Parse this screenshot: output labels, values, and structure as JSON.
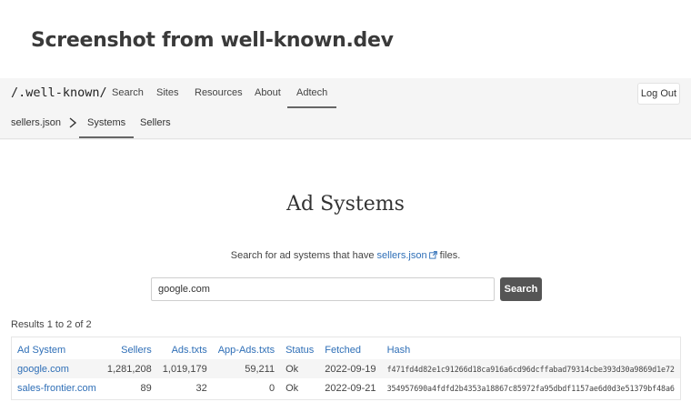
{
  "page_title": "Screenshot from well-known.dev",
  "topnav": {
    "brand": "/.well-known/",
    "items": [
      "Search",
      "Sites",
      "Resources",
      "About",
      "Adtech"
    ],
    "active": "Adtech",
    "logout_label": "Log Out"
  },
  "subnav": {
    "root": "sellers.json",
    "items": [
      "Systems",
      "Sellers"
    ],
    "active": "Systems"
  },
  "main": {
    "title": "Ad Systems",
    "subtitle_prefix": "Search for ad systems that have",
    "subtitle_link": "sellers.json",
    "subtitle_suffix": "files.",
    "search_value": "google.com",
    "search_button": "Search",
    "results_count": "Results 1 to 2 of 2"
  },
  "table": {
    "headers": [
      "Ad System",
      "Sellers",
      "Ads.txts",
      "App-Ads.txts",
      "Status",
      "Fetched",
      "Hash"
    ],
    "rows": [
      [
        "google.com",
        "1,281,208",
        "1,019,179",
        "59,211",
        "Ok",
        "2022-09-19",
        "f471fd4d82e1c91266d18ca916a6cd96dcffabad79314cbe393d30a9869d1e72"
      ],
      [
        "sales-frontier.com",
        "89",
        "32",
        "0",
        "Ok",
        "2022-09-21",
        "354957690a4fdfd2b4353a18867c85972fa95dbdf1157ae6d0d3e51379bf48a6"
      ]
    ]
  },
  "colors": {
    "link": "#2f6fb7",
    "button": "#555555"
  }
}
